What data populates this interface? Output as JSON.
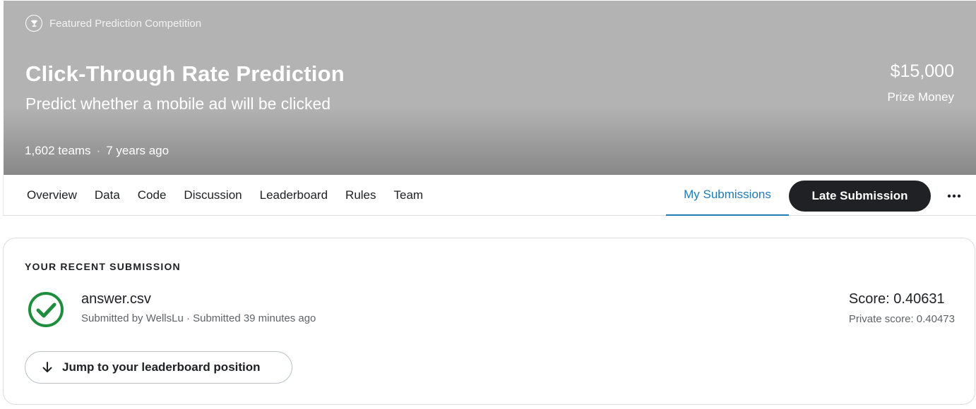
{
  "header": {
    "badge_icon": "trophy-icon",
    "badge_text": "Featured Prediction Competition",
    "title": "Click-Through Rate Prediction",
    "subtitle": "Predict whether a mobile ad will be clicked",
    "teams": "1,602 teams",
    "separator": "·",
    "age": "7 years ago",
    "prize_amount": "$15,000",
    "prize_label": "Prize Money"
  },
  "nav": {
    "tabs": [
      {
        "label": "Overview"
      },
      {
        "label": "Data"
      },
      {
        "label": "Code"
      },
      {
        "label": "Discussion"
      },
      {
        "label": "Leaderboard"
      },
      {
        "label": "Rules"
      },
      {
        "label": "Team"
      }
    ],
    "active_tab": "My Submissions",
    "late_submission": "Late Submission",
    "more_icon": "more-horizontal-icon"
  },
  "submission": {
    "heading": "YOUR RECENT SUBMISSION",
    "status_icon": "check-circle-icon",
    "file_name": "answer.csv",
    "meta": "Submitted by WellsLu · Submitted 39 minutes ago",
    "score": "Score: 0.40631",
    "private_score": "Private score: 0.40473",
    "jump_label": "Jump to your leaderboard position",
    "jump_icon": "arrow-down-icon"
  },
  "colors": {
    "accent": "#1f7bb6",
    "success": "#1e8e3e",
    "dark_button": "#202124"
  }
}
